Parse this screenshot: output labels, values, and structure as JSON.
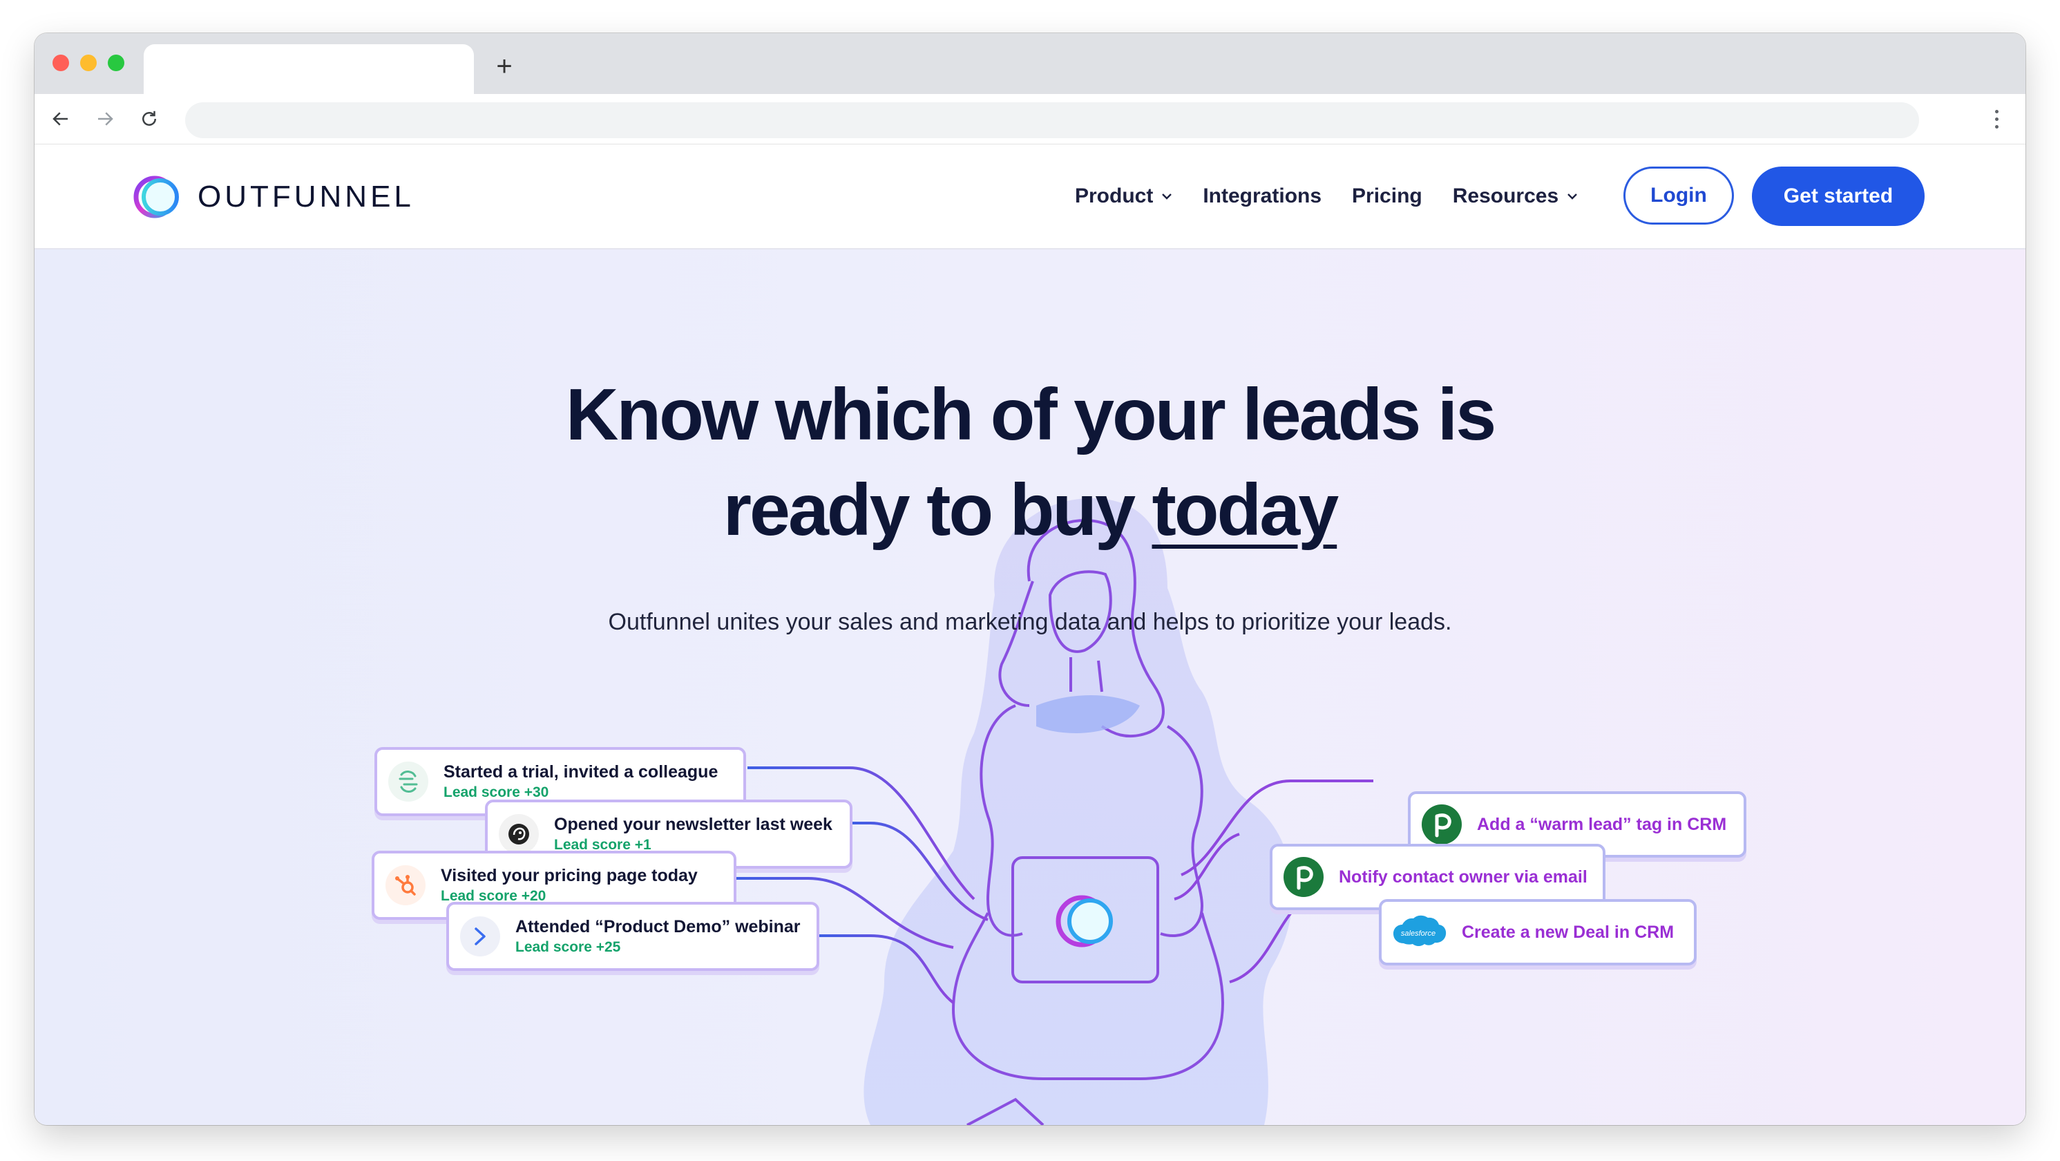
{
  "browser": {
    "tab_title": "",
    "new_tab_symbol": "+",
    "url": ""
  },
  "header": {
    "logo_text": "OUTFUNNEL",
    "nav": [
      {
        "label": "Product",
        "has_dropdown": true
      },
      {
        "label": "Integrations",
        "has_dropdown": false
      },
      {
        "label": "Pricing",
        "has_dropdown": false
      },
      {
        "label": "Resources",
        "has_dropdown": true
      }
    ],
    "login_label": "Login",
    "cta_label": "Get started"
  },
  "hero": {
    "headline_line1": "Know which of your leads is",
    "headline_line2_start": "ready to buy ",
    "headline_line2_emph": "today",
    "subheadline": "Outfunnel unites your sales and marketing data and helps to prioritize your leads."
  },
  "signals": [
    {
      "title": "Started a trial, invited a colleague",
      "score": "Lead score +30",
      "icon": "segment-icon"
    },
    {
      "title": "Opened your newsletter last week",
      "score": "Lead score +1",
      "icon": "mailchimp-icon"
    },
    {
      "title": "Visited your pricing page today",
      "score": "Lead score +20",
      "icon": "hubspot-icon"
    },
    {
      "title": "Attended “Product Demo” webinar",
      "score": "Lead score +25",
      "icon": "webinar-icon"
    }
  ],
  "actions": [
    {
      "title": "Add a “warm lead” tag in CRM",
      "icon": "pipedrive-icon"
    },
    {
      "title": "Notify contact owner via email",
      "icon": "pipedrive-icon"
    },
    {
      "title": "Create a new Deal in CRM",
      "icon": "salesforce-icon",
      "icon_text": "salesforce"
    }
  ],
  "colors": {
    "brand_blue": "#2157e6",
    "navy": "#0e1636",
    "score_green": "#15a36b",
    "action_purple": "#9a2fd4"
  }
}
